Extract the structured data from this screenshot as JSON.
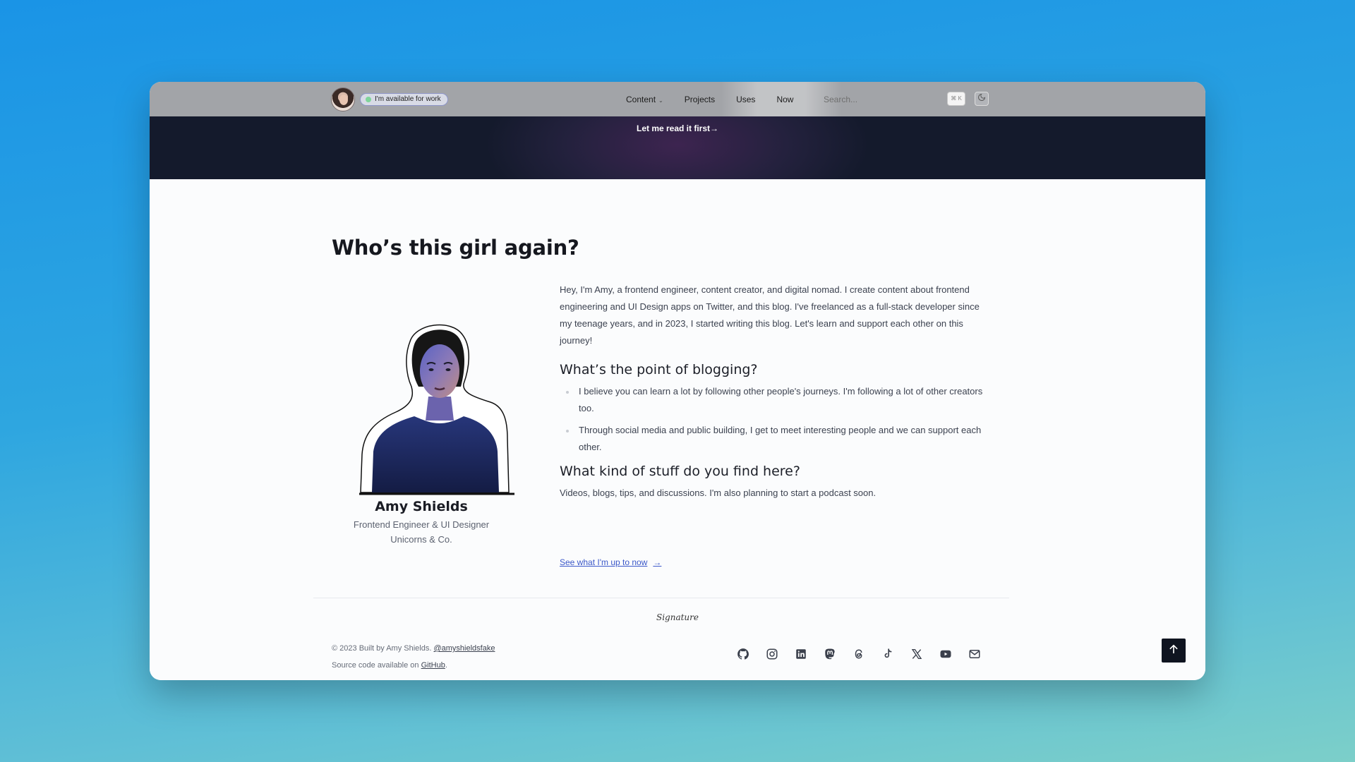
{
  "nav": {
    "availability_label": "I'm available for work",
    "links": [
      {
        "label": "Content",
        "has_dropdown": true
      },
      {
        "label": "Projects"
      },
      {
        "label": "Uses"
      },
      {
        "label": "Now"
      }
    ],
    "search_placeholder": "Search...",
    "shortcut": "⌘ K",
    "theme_icon": "moon-icon"
  },
  "hero": {
    "link_label": "Let me read it first",
    "link_arrow": "→"
  },
  "about": {
    "title": "Who’s this girl again?",
    "name": "Amy Shields",
    "role": "Frontend Engineer & UI Designer",
    "company": "Unicorns & Co.",
    "intro": "Hey, I'm Amy, a frontend engineer, content creator, and digital nomad. I create content about frontend engineering and UI Design apps on Twitter, and this blog. I've freelanced as a full-stack developer since my teenage years, and in 2023, I started writing this blog. Let's learn and support each other on this journey!",
    "section1_title": "What’s the point of blogging?",
    "bullets": [
      "I believe you can learn a lot by following other people's journeys. I'm following a lot of other creators too.",
      "Through social media and public building, I get to meet interesting people and we can support each other."
    ],
    "section2_title": "What kind of stuff do you find here?",
    "section2_text": "Videos, blogs, tips, and discussions. I'm also planning to start a podcast soon.",
    "now_link": "See what I'm up to now",
    "now_arrow": "→"
  },
  "footer": {
    "signature": "Signature",
    "copyright": "© 2023 Built by Amy Shields.",
    "handle": "@amyshieldsfake",
    "source_prefix": "Source code available on",
    "source_link": "GitHub",
    "source_suffix": ".",
    "social_icons": [
      "github-icon",
      "instagram-icon",
      "linkedin-icon",
      "mastodon-icon",
      "threads-icon",
      "tiktok-icon",
      "x-icon",
      "youtube-icon",
      "mail-icon"
    ],
    "back_to_top_icon": "arrow-up-icon"
  },
  "colors": {
    "background_gradient_start": "#1a94e6",
    "background_gradient_end": "#7ccfc9",
    "nav_bg": "#a2a4a8",
    "hero_bg": "#141a2c",
    "link": "#3b58c9",
    "available_dot": "#7fd49a"
  }
}
